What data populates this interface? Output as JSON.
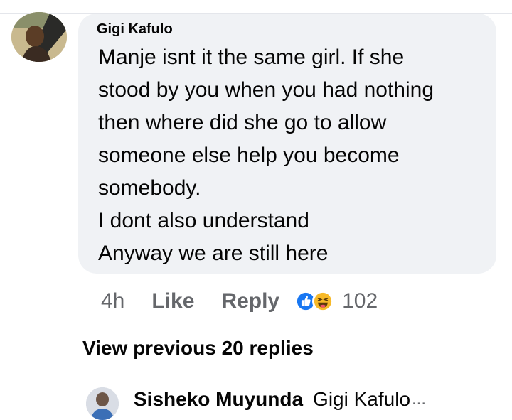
{
  "comment": {
    "author": "Gigi Kafulo",
    "text_lines": [
      "Manje isnt it the  same girl. If she",
      "stood by you when you had nothing",
      "then where did she go to allow",
      "someone else help you become",
      "somebody.",
      "I dont also understand",
      "Anyway we are still here"
    ],
    "time": "4h",
    "like_label": "Like",
    "reply_label": "Reply",
    "reaction_count": "102",
    "reaction_icons": [
      "like-reaction-icon",
      "haha-reaction-icon"
    ]
  },
  "replies": {
    "view_previous_label": "View previous 20 replies",
    "latest": {
      "author": "Sisheko Muyunda",
      "snippet": "Gigi Kafulo",
      "ellipsis": "..."
    }
  },
  "colors": {
    "bubble_bg": "#f0f2f5",
    "text_primary": "#050505",
    "text_secondary": "#65676b",
    "like_blue": "#1877f2",
    "haha_yellow": "#f7b928"
  }
}
